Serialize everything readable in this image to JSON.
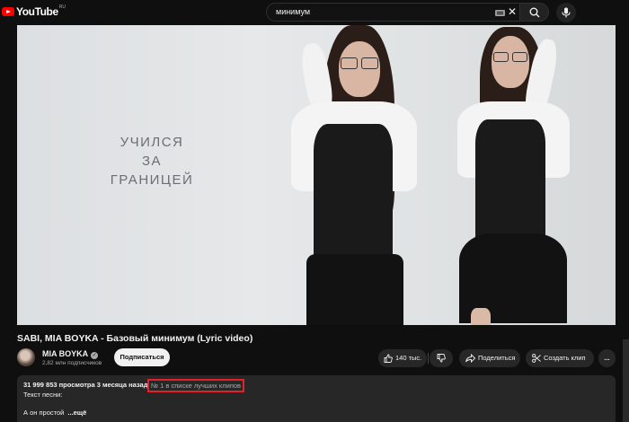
{
  "header": {
    "logo_text": "YouTube",
    "logo_region": "RU",
    "search_value": "минимум"
  },
  "video": {
    "caption_line1": "УЧИЛСЯ",
    "caption_line2": "ЗА ГРАНИЦЕЙ"
  },
  "title": "SABI, MIA BOYKA - Базовый минимум (Lyric video)",
  "channel": {
    "name": "MIA BOYKA",
    "subscribers": "2,82 млн подписчиков",
    "subscribe_label": "Подписаться"
  },
  "actions": {
    "like_count": "140 тыс.",
    "share_label": "Поделиться",
    "clip_label": "Создать клип",
    "more_label": "..."
  },
  "description": {
    "stats": "31 999 853 просмотра  3 месяца назад",
    "rank": "№ 1 в списке лучших клипов",
    "line1": "Текст песни:",
    "line2": "А он простой",
    "more": "...ещё"
  },
  "colors": {
    "background": "#0f0f0f",
    "brand_red": "#ff0000",
    "highlight_box": "#e3212a"
  }
}
